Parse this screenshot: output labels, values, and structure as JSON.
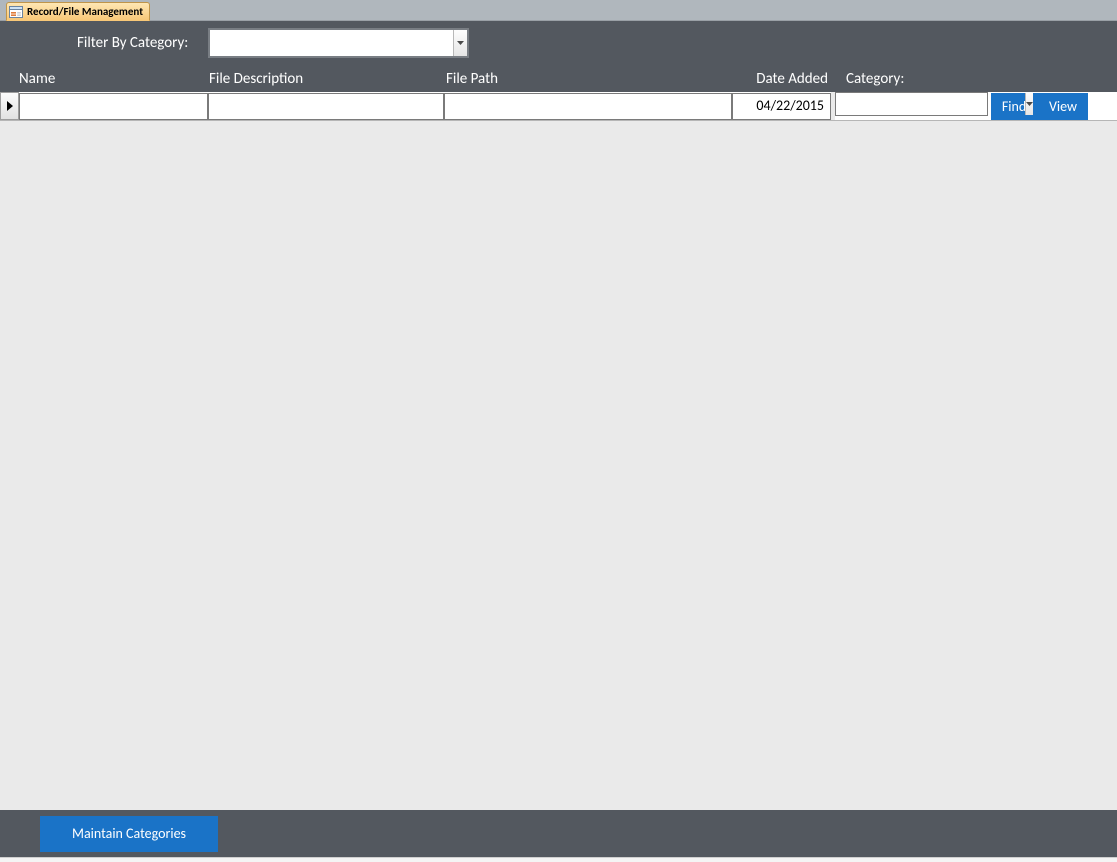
{
  "tab": {
    "title": "Record/File Management",
    "icon_name": "form-icon"
  },
  "filter": {
    "label": "Filter By Category:",
    "value": ""
  },
  "columns": {
    "name": "Name",
    "description": "File Description",
    "path": "File Path",
    "date_added": "Date Added",
    "category": "Category:"
  },
  "row": {
    "name": "",
    "description": "",
    "path": "",
    "date_added": "04/22/2015",
    "category": ""
  },
  "buttons": {
    "find": "Find",
    "view": "View",
    "maintain": "Maintain Categories"
  },
  "colors": {
    "accent": "#1a73c7",
    "band": "#53585f",
    "tab_bg": "#f8c878"
  }
}
